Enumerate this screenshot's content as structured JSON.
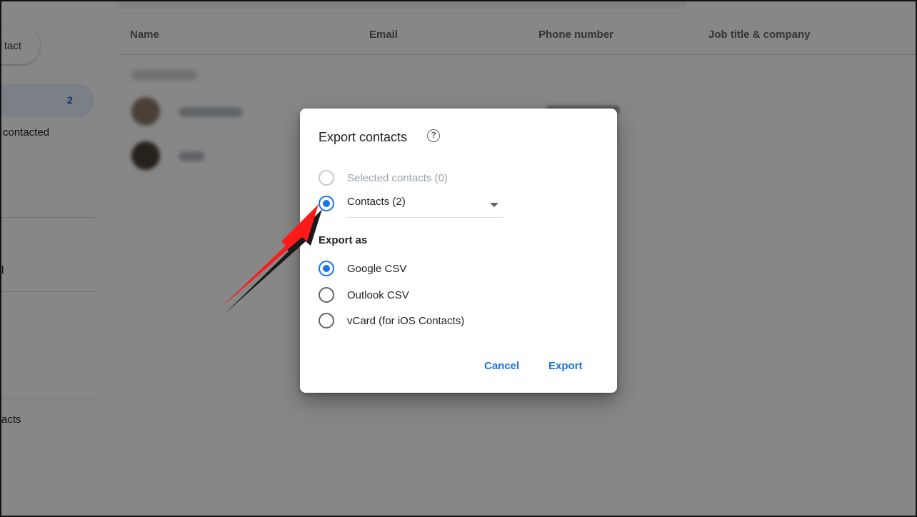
{
  "background": {
    "create_button_label": "tact",
    "nav_count": "2",
    "nav_item_contacted": "contacted",
    "nav_item_partial": "l",
    "nav_item_contacts": "acts",
    "columns": [
      "Name",
      "Email",
      "Phone number",
      "Job title & company"
    ]
  },
  "dialog": {
    "title": "Export contacts",
    "help_glyph": "?",
    "scope_options": [
      {
        "label": "Selected contacts (0)",
        "checked": false,
        "disabled": true
      },
      {
        "label": "Contacts (2)",
        "checked": true,
        "disabled": false
      }
    ],
    "scope_select_value": "Contacts (2)",
    "export_as_label": "Export as",
    "format_options": [
      {
        "label": "Google CSV",
        "checked": true
      },
      {
        "label": "Outlook CSV",
        "checked": false
      },
      {
        "label": "vCard (for iOS Contacts)",
        "checked": false
      }
    ],
    "cancel_label": "Cancel",
    "export_label": "Export"
  },
  "colors": {
    "accent": "#1a73e8",
    "annotation_arrow": "#ff1a1a"
  }
}
